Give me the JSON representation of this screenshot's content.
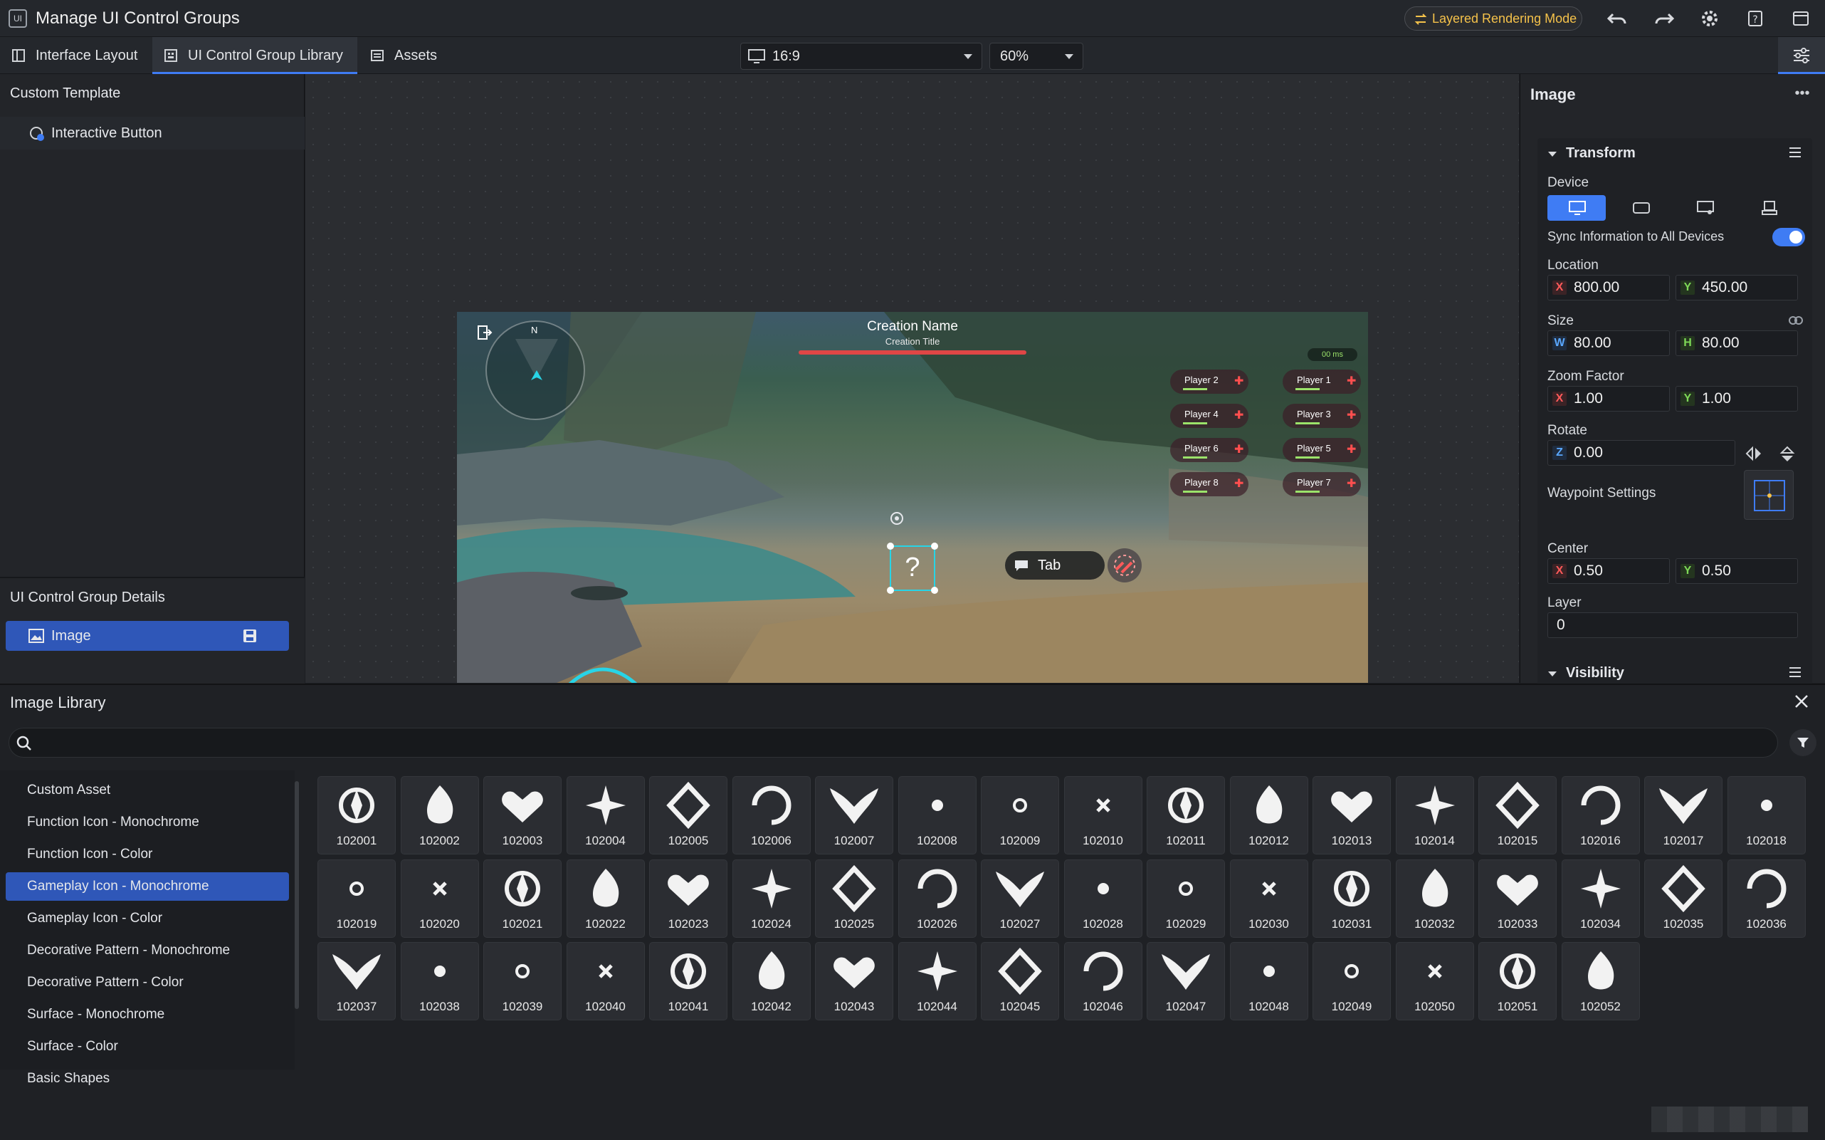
{
  "window": {
    "app_badge": "UI",
    "title": "Manage UI Control Groups",
    "layered_rendering_label": "Layered Rendering Mode"
  },
  "tabs": [
    {
      "label": "Interface Layout",
      "icon": "layout-icon"
    },
    {
      "label": "UI Control Group Library",
      "icon": "library-icon",
      "active": true
    },
    {
      "label": "Assets",
      "icon": "assets-icon"
    }
  ],
  "toolbar": {
    "aspect_ratio": "16:9",
    "zoom": "60%"
  },
  "left_panel": {
    "custom_template_title": "Custom Template",
    "template_items": [
      "Interactive Button"
    ],
    "details_title": "UI Control Group Details",
    "detail_item": "Image"
  },
  "scene": {
    "creation_name": "Creation Name",
    "creation_title": "Creation Title",
    "compass_n": "N",
    "ping": "00 ms",
    "players": [
      "Player 2",
      "Player 1",
      "Player 4",
      "Player 3",
      "Player 6",
      "Player 5",
      "Player 8",
      "Player 7"
    ],
    "tab_label": "Tab",
    "placeholder_glyph": "?"
  },
  "right_panel": {
    "header": "Image",
    "transform_title": "Transform",
    "device_label": "Device",
    "sync_label": "Sync Information to All Devices",
    "sync_on": true,
    "location_label": "Location",
    "location": {
      "x": "800.00",
      "y": "450.00"
    },
    "size_label": "Size",
    "size": {
      "w": "80.00",
      "h": "80.00"
    },
    "zoom_label": "Zoom Factor",
    "zoom_factor": {
      "x": "1.00",
      "y": "1.00"
    },
    "rotate_label": "Rotate",
    "rotate": {
      "z": "0.00"
    },
    "waypoint_label": "Waypoint Settings",
    "center_label": "Center",
    "center": {
      "x": "0.50",
      "y": "0.50"
    },
    "layer_label": "Layer",
    "layer": "0",
    "visibility_title": "Visibility",
    "axis": {
      "x": "X",
      "y": "Y",
      "z": "Z",
      "w": "W",
      "h": "H"
    }
  },
  "library": {
    "title": "Image Library",
    "search_placeholder": "",
    "categories": [
      "Custom Asset",
      "Function Icon - Monochrome",
      "Function Icon - Color",
      "Gameplay Icon - Monochrome",
      "Gameplay Icon - Color",
      "Decorative Pattern - Monochrome",
      "Decorative Pattern - Color",
      "Surface - Monochrome",
      "Surface - Color",
      "Basic Shapes"
    ],
    "active_category": "Gameplay Icon - Monochrome",
    "icons": [
      "102001",
      "102002",
      "102003",
      "102004",
      "102005",
      "102006",
      "102007",
      "102008",
      "102009",
      "102010",
      "102011",
      "102012",
      "102013",
      "102014",
      "102015",
      "102016",
      "102017",
      "102018",
      "102019",
      "102020",
      "102021",
      "102022",
      "102023",
      "102024",
      "102025",
      "102026",
      "102027",
      "102028",
      "102029",
      "102030",
      "102031",
      "102032",
      "102033",
      "102034",
      "102035",
      "102036",
      "102037",
      "102038",
      "102039",
      "102040",
      "102041",
      "102042",
      "102043",
      "102044",
      "102045",
      "102046",
      "102047",
      "102048",
      "102049",
      "102050",
      "102051",
      "102052"
    ]
  },
  "colors": {
    "accent": "#3f7cf4",
    "selection": "#2f57b8",
    "gold": "#f5c24a",
    "health_red": "#e04646"
  }
}
